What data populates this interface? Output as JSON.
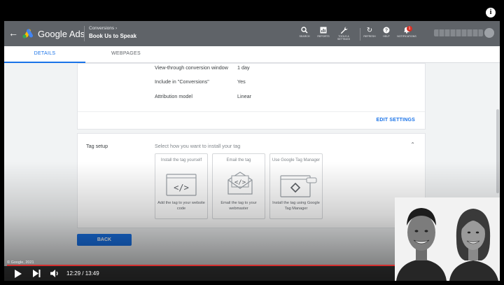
{
  "header": {
    "brand": "Google Ads",
    "crumb": "Conversions",
    "page_title": "Book Us to Speak",
    "tools": [
      {
        "label": "SEARCH",
        "icon": "search-icon"
      },
      {
        "label": "REPORTS",
        "icon": "reports-icon"
      },
      {
        "label": "TOOLS & SETTINGS",
        "icon": "wrench-icon"
      },
      {
        "label": "REFRESH",
        "icon": "refresh-icon"
      },
      {
        "label": "HELP",
        "icon": "help-icon"
      },
      {
        "label": "NOTIFICATIONS",
        "icon": "bell-icon"
      }
    ],
    "notification_count": "1"
  },
  "tabs": [
    {
      "label": "DETAILS",
      "active": true
    },
    {
      "label": "WEBPAGES",
      "active": false
    }
  ],
  "settings": {
    "rows": [
      {
        "label": "View-through conversion window",
        "value": "1 day"
      },
      {
        "label": "Include in \"Conversions\"",
        "value": "Yes"
      },
      {
        "label": "Attribution model",
        "value": "Linear"
      }
    ],
    "edit_label": "EDIT SETTINGS"
  },
  "tag_setup": {
    "title": "Tag setup",
    "subtitle": "Select how you want to install your tag",
    "options": [
      {
        "title": "Install the tag yourself",
        "desc": "Add the tag to your website code",
        "icon": "code-window-icon"
      },
      {
        "title": "Email the tag",
        "desc": "Email the tag to your webmaster",
        "icon": "email-code-icon"
      },
      {
        "title": "Use Google Tag Manager",
        "desc": "Install the tag using Google Tag Manager",
        "icon": "tag-manager-icon"
      }
    ]
  },
  "back_label": "BACK",
  "player": {
    "copyright": "© Google, 2021",
    "time": "12:29 / 13:49",
    "progress": 0.9034
  },
  "colors": {
    "accent": "#1a73e8",
    "header": "#5f6368",
    "progress": "#d32f2f"
  }
}
